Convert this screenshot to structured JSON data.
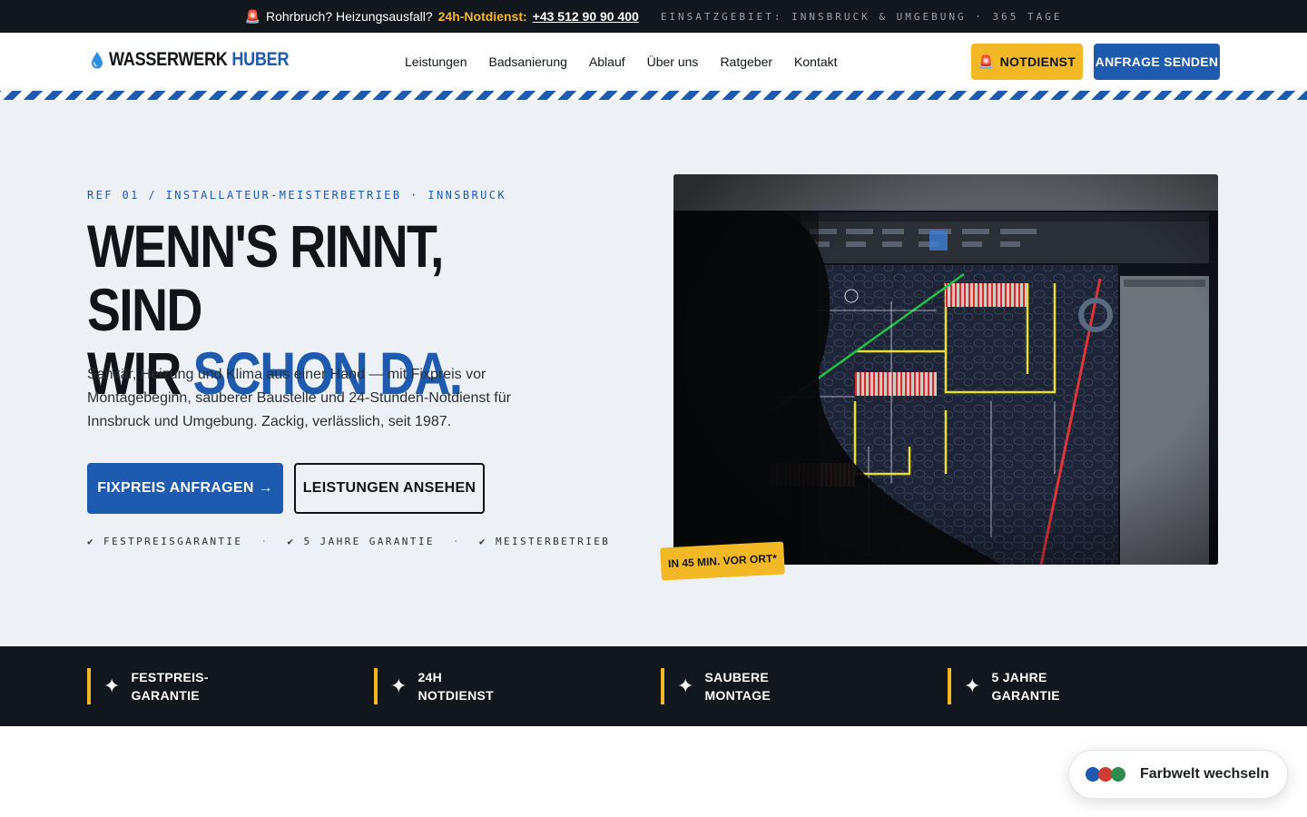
{
  "topbar": {
    "emergency_icon": "siren-icon",
    "question": "Rohrbruch? Heizungsausfall?",
    "hotline_label": "24h-Notdienst:",
    "phone": "+43 512 90 90 400",
    "service_area": "EINSATZGEBIET: INNSBRUCK & UMGEBUNG · 365 TAGE"
  },
  "nav": {
    "logo_icon": "water-drop-icon",
    "logo_part1": "WASSERWERK",
    "logo_part2": "HUBER",
    "items": [
      {
        "label": "Leistungen"
      },
      {
        "label": "Badsanierung"
      },
      {
        "label": "Ablauf"
      },
      {
        "label": "Über uns"
      },
      {
        "label": "Ratgeber"
      },
      {
        "label": "Kontakt"
      }
    ],
    "emergency_button": "NOTDIENST",
    "request_button": "ANFRAGE SENDEN"
  },
  "hero": {
    "eyebrow": "REF 01 / INSTALLATEUR-MEISTERBETRIEB · INNSBRUCK",
    "headline_line1": "WENN'S RINNT, SIND",
    "headline_line2_a": "WIR ",
    "headline_line2_b": "SCHON DA.",
    "lead": "Sanitär, Heizung und Klima aus einer Hand — mit Fixpreis vor Montagebeginn, sauberer Baustelle und 24-Stunden-Notdienst für Innsbruck und Umgebung. Zackig, verlässlich, seit 1987.",
    "cta_primary": "FIXPREIS ANFRAGEN →",
    "cta_secondary": "LEISTUNGEN ANSEHEN",
    "trust": [
      "✔ FESTPREISGARANTIE",
      "✔ 5 JAHRE GARANTIE",
      "✔ MEISTERBETRIEB"
    ],
    "trust_separator": "·",
    "image_badge": "IN 45 MIN. VOR ORT*"
  },
  "features": [
    {
      "icon": "sparkle-icon",
      "label": "FESTPREIS-\nGARANTIE"
    },
    {
      "icon": "sparkle-icon",
      "label": "24H\nNOTDIENST"
    },
    {
      "icon": "sparkle-icon",
      "label": "SAUBERE\nMONTAGE"
    },
    {
      "icon": "sparkle-icon",
      "label": "5 JAHRE\nGARANTIE"
    }
  ],
  "theme_switcher": {
    "label": "Farbwelt wechseln",
    "swatches": [
      "#1d5ab0",
      "#d23b2f",
      "#2e8b4e"
    ]
  },
  "colors": {
    "brand_blue": "#1d5ab0",
    "accent_yellow": "#f2b826",
    "dark": "#12161d"
  }
}
